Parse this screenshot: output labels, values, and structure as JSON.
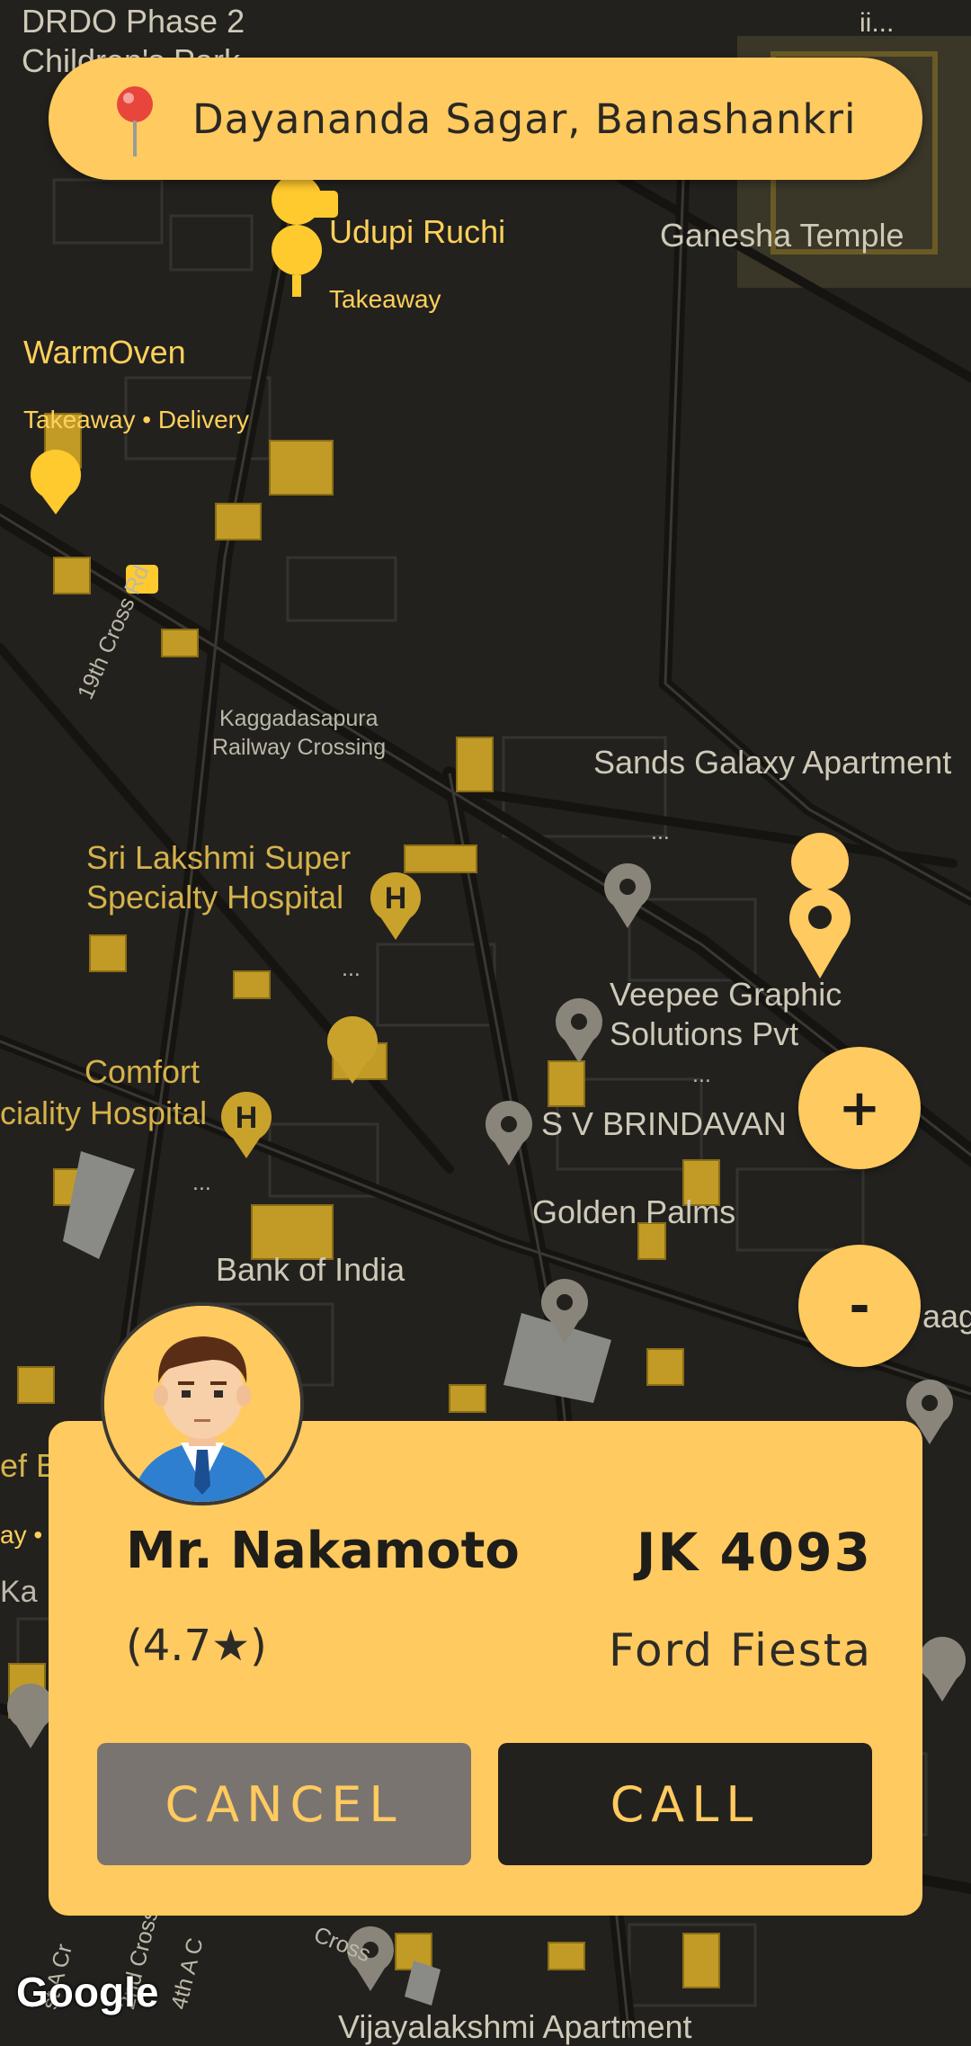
{
  "search": {
    "location": "Dayananda Sagar, Banashankri",
    "pin_icon": "map-pin-icon"
  },
  "map": {
    "labels": {
      "drdo": "DRDO Phase 2",
      "childrens_park": "Children's Park",
      "ii": "ii...",
      "udupi": "Udupi Ruchi",
      "udupi_sub": "Takeaway",
      "ganesha": "Ganesha Temple",
      "warmoven": "WarmOven",
      "warmoven_sub": "Takeaway • Delivery",
      "cross_rd": "19th Cross Rd",
      "kaggadasapura": "Kaggadasapura",
      "railway_crossing": "Railway Crossing",
      "sands": "Sands Galaxy Apartment",
      "sands_more": "...",
      "sri_lakshmi_1": "Sri Lakshmi Super",
      "sri_lakshmi_2": "Specialty Hospital",
      "hospital_more": "...",
      "veepee_1": "Veepee Graphic",
      "veepee_2": "Solutions Pvt",
      "veepee_more": "...",
      "comfort_1": "Comfort",
      "comfort_2": "ciality Hospital",
      "comfort_more": "...",
      "sv_brindavan": "S V BRINDAVAN",
      "golden_palms": "Golden Palms",
      "bank_of_india": "Bank of India",
      "aag": "aag",
      "ef_b": "ef B",
      "ay": "ay •",
      "ka": "Ka",
      "vijayalakshmi": "Vijayalakshmi Apartment",
      "cross": "Cross",
      "st_a_cr": "st A Cr",
      "nd_cross": "2nd Cross",
      "th_a_c": "4th A C"
    },
    "logo": "Google"
  },
  "zoom": {
    "in_label": "+",
    "out_label": "-"
  },
  "driver": {
    "name": "Mr. Nakamoto",
    "rating": "(4.7★)",
    "plate": "JK 4093",
    "car": "Ford Fiesta",
    "cancel_label": "CANCEL",
    "call_label": "CALL"
  },
  "colors": {
    "accent": "#ffca5f",
    "map_bg": "#22211e",
    "dark": "#22211e",
    "cancel_bg": "#7a7470"
  }
}
